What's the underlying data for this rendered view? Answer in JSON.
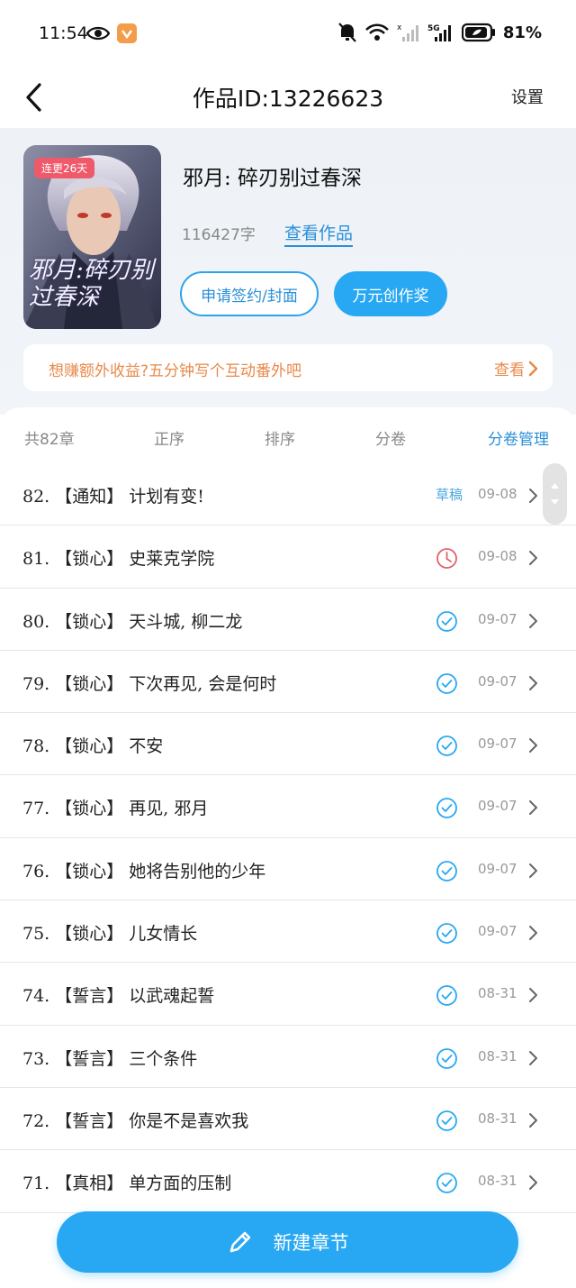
{
  "status_bar": {
    "time": "11:54",
    "battery": "81%",
    "network": "5G"
  },
  "nav": {
    "title": "作品ID:13226623",
    "settings": "设置"
  },
  "book": {
    "badge": "连更26天",
    "cover_text": "邪月:碎刃别过春深",
    "title": "邪月: 碎刃别过春深",
    "word_count": "116427字",
    "view_work": "查看作品",
    "apply_button": "申请签约/封面",
    "award_button": "万元创作奖"
  },
  "promo": {
    "text": "想赚额外收益?五分钟写个互动番外吧",
    "link": "查看"
  },
  "tabs": [
    {
      "label": "共82章"
    },
    {
      "label": "正序"
    },
    {
      "label": "排序"
    },
    {
      "label": "分卷"
    },
    {
      "label": "分卷管理"
    }
  ],
  "chapters": [
    {
      "title": "82. 【通知】 计划有变!",
      "status": "draft",
      "status_label": "草稿",
      "date": "09-08"
    },
    {
      "title": "81. 【锁心】 史莱克学院",
      "status": "pending",
      "date": "09-08"
    },
    {
      "title": "80. 【锁心】 天斗城, 柳二龙",
      "status": "published",
      "date": "09-07"
    },
    {
      "title": "79. 【锁心】 下次再见, 会是何时",
      "status": "published",
      "date": "09-07"
    },
    {
      "title": "78. 【锁心】 不安",
      "status": "published",
      "date": "09-07"
    },
    {
      "title": "77. 【锁心】 再见, 邪月",
      "status": "published",
      "date": "09-07"
    },
    {
      "title": "76. 【锁心】 她将告别他的少年",
      "status": "published",
      "date": "09-07"
    },
    {
      "title": "75. 【锁心】 儿女情长",
      "status": "published",
      "date": "09-07"
    },
    {
      "title": "74. 【誓言】 以武魂起誓",
      "status": "published",
      "date": "08-31"
    },
    {
      "title": "73. 【誓言】 三个条件",
      "status": "published",
      "date": "08-31"
    },
    {
      "title": "72. 【誓言】 你是不是喜欢我",
      "status": "published",
      "date": "08-31"
    },
    {
      "title": "71. 【真相】 单方面的压制",
      "status": "published",
      "date": "08-31"
    }
  ],
  "new_chapter_label": "新建章节",
  "colors": {
    "accent": "#28a8f2",
    "promo": "#e8894a",
    "pending": "#e0626b"
  }
}
